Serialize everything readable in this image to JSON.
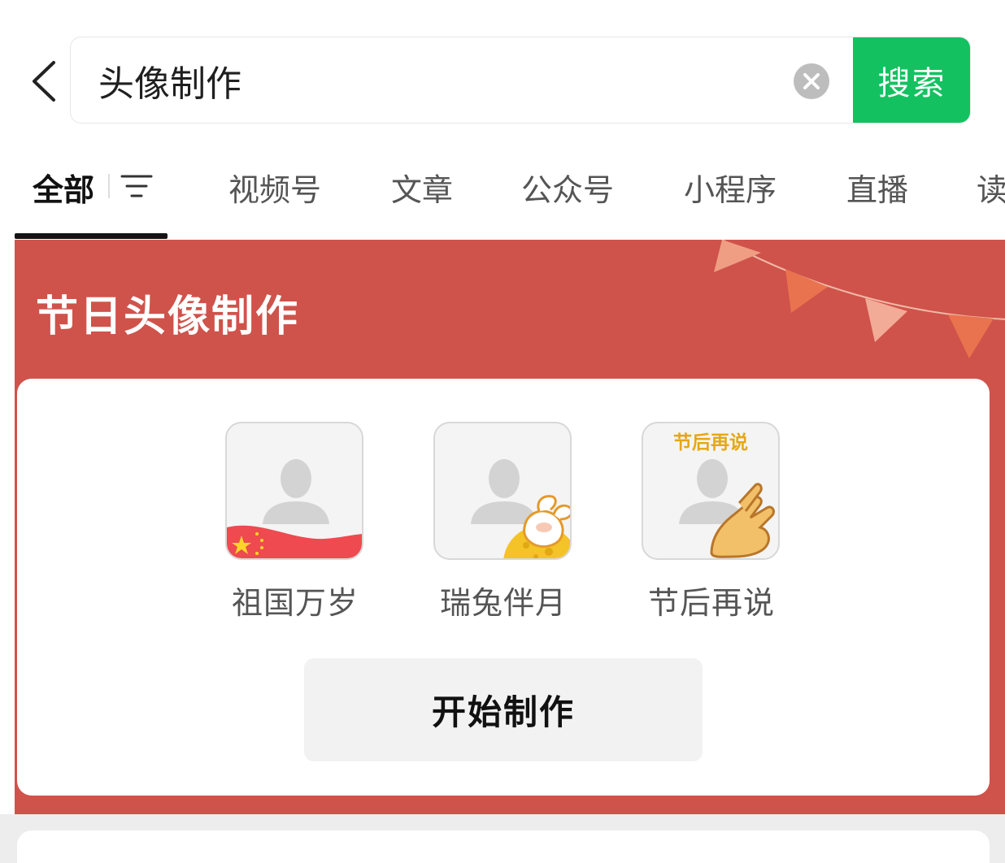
{
  "search": {
    "query": "头像制作",
    "button_label": "搜索"
  },
  "tabs": {
    "items": [
      {
        "label": "全部",
        "active": true
      },
      {
        "label": "视频号"
      },
      {
        "label": "文章"
      },
      {
        "label": "公众号"
      },
      {
        "label": "小程序"
      },
      {
        "label": "直播"
      },
      {
        "label": "读"
      }
    ]
  },
  "festival": {
    "title": "节日头像制作",
    "avatars": [
      {
        "label": "祖国万岁",
        "decoration": "china-flag"
      },
      {
        "label": "瑞兔伴月",
        "decoration": "rabbit-moon"
      },
      {
        "label": "节后再说",
        "decoration": "hands-clasp",
        "frame_text": "节后再说"
      }
    ],
    "start_button": "开始制作"
  },
  "colors": {
    "accent": "#13c160",
    "banner": "#cf534b"
  }
}
